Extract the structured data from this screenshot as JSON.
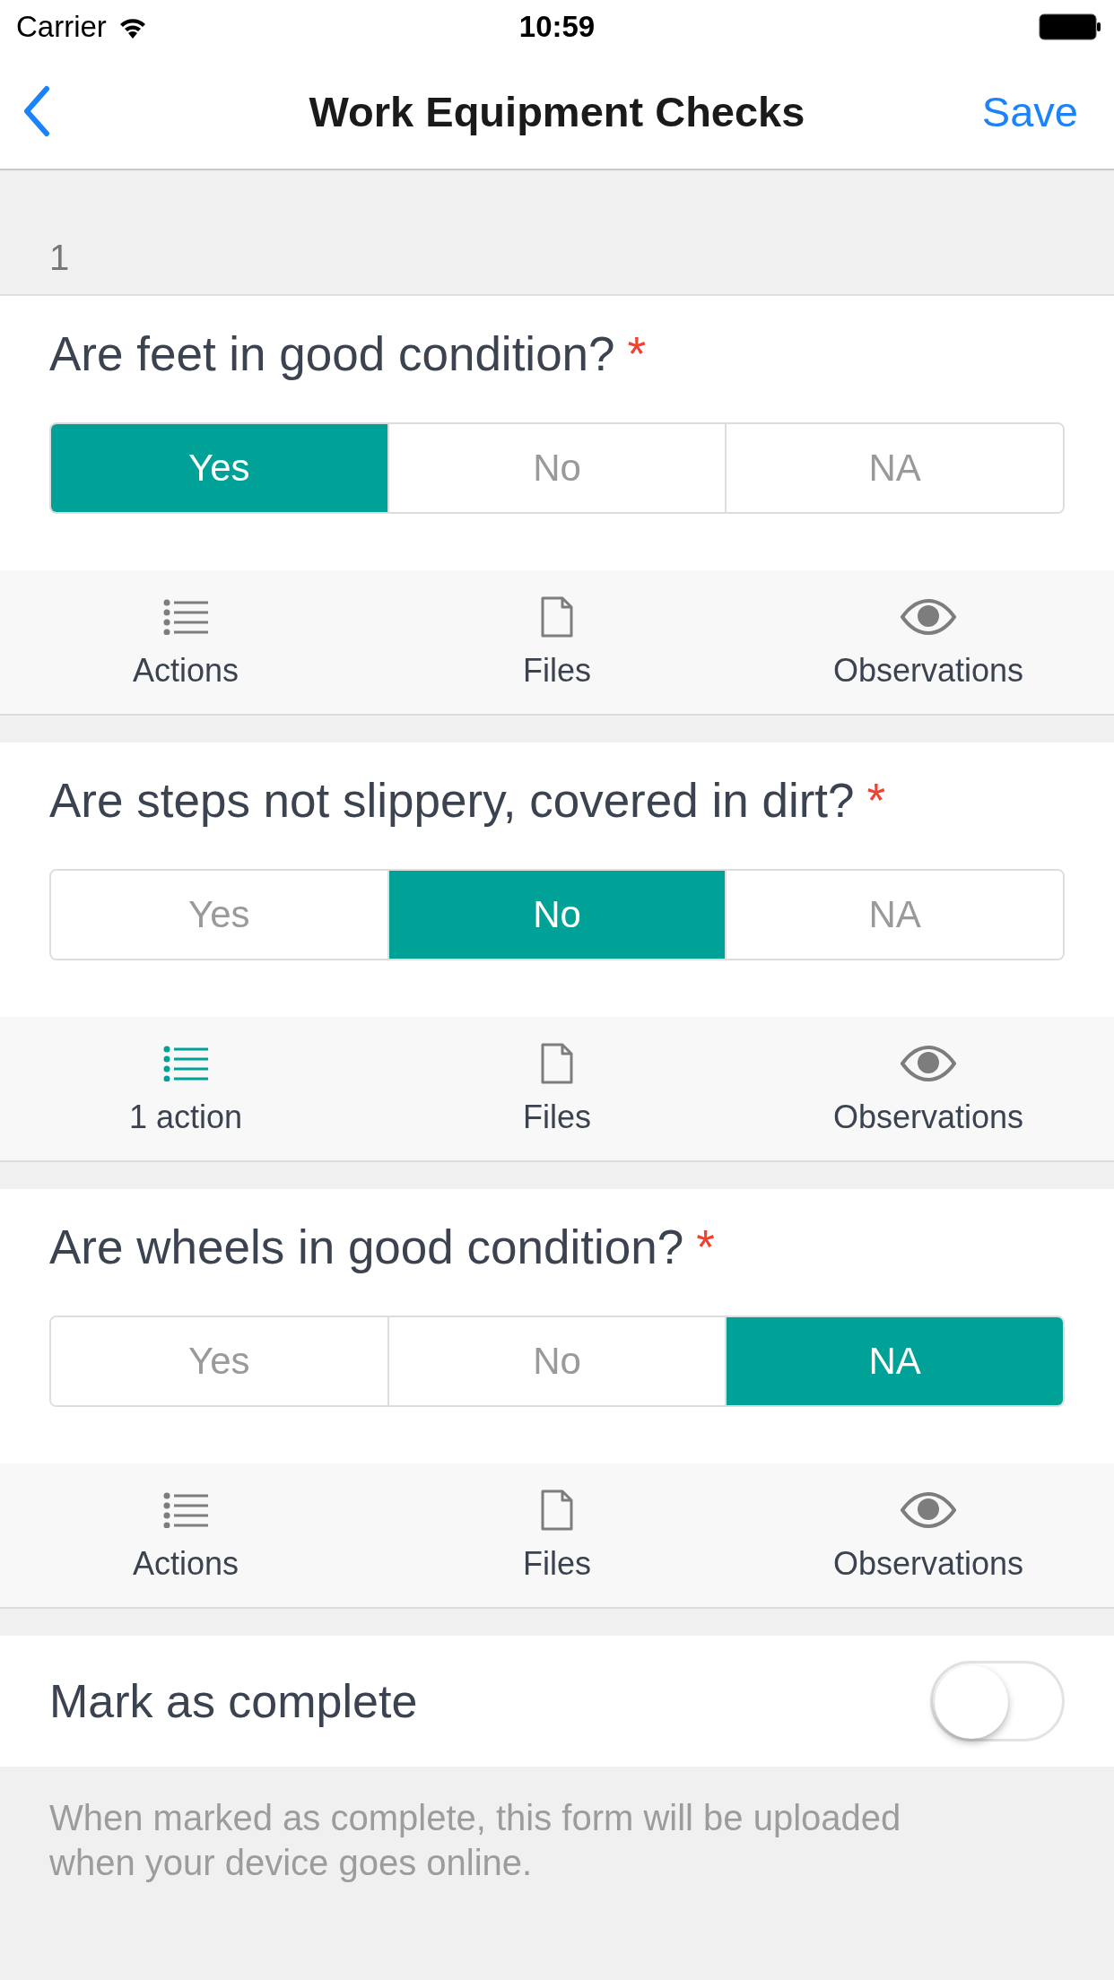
{
  "status_bar": {
    "carrier": "Carrier",
    "time": "10:59"
  },
  "nav": {
    "title": "Work Equipment Checks",
    "save": "Save"
  },
  "section": {
    "number": "1"
  },
  "questions": [
    {
      "text": "Are feet in good condition?",
      "required": true,
      "mark": "*",
      "options": [
        {
          "label": "Yes",
          "selected": true
        },
        {
          "label": "No",
          "selected": false
        },
        {
          "label": "NA",
          "selected": false
        }
      ],
      "tools": [
        {
          "kind": "actions",
          "label": "Actions",
          "highlighted": false
        },
        {
          "kind": "files",
          "label": "Files",
          "highlighted": false
        },
        {
          "kind": "observations",
          "label": "Observations",
          "highlighted": false
        }
      ]
    },
    {
      "text": "Are steps not slippery, covered in dirt?",
      "required": true,
      "mark": "*",
      "options": [
        {
          "label": "Yes",
          "selected": false
        },
        {
          "label": "No",
          "selected": true
        },
        {
          "label": "NA",
          "selected": false
        }
      ],
      "tools": [
        {
          "kind": "actions",
          "label": "1 action",
          "highlighted": true
        },
        {
          "kind": "files",
          "label": "Files",
          "highlighted": false
        },
        {
          "kind": "observations",
          "label": "Observations",
          "highlighted": false
        }
      ]
    },
    {
      "text": "Are wheels in good condition?",
      "required": true,
      "mark": "*",
      "options": [
        {
          "label": "Yes",
          "selected": false
        },
        {
          "label": "No",
          "selected": false
        },
        {
          "label": "NA",
          "selected": true
        }
      ],
      "tools": [
        {
          "kind": "actions",
          "label": "Actions",
          "highlighted": false
        },
        {
          "kind": "files",
          "label": "Files",
          "highlighted": false
        },
        {
          "kind": "observations",
          "label": "Observations",
          "highlighted": false
        }
      ]
    }
  ],
  "complete": {
    "label": "Mark as complete",
    "on": false
  },
  "footer": "When marked as complete, this form will be uploaded when your device goes online."
}
